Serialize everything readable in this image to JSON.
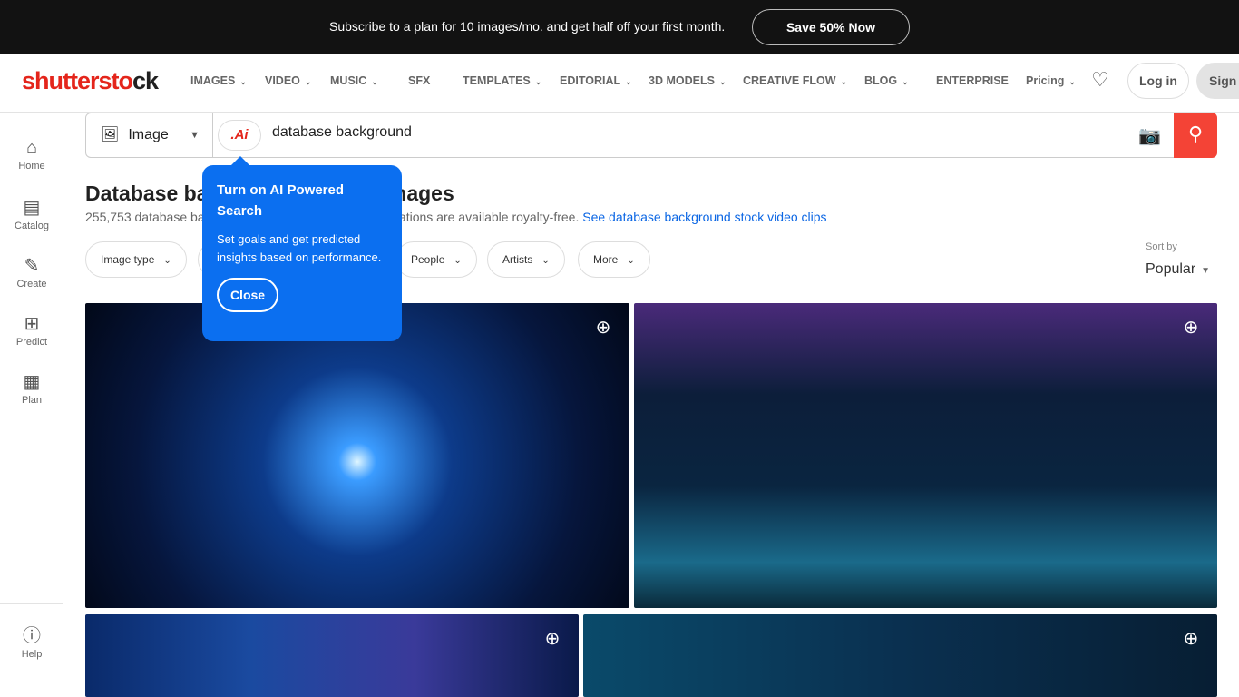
{
  "banner": {
    "message": "Subscribe to a plan for 10 images/mo. and get half off your first month.",
    "cta": "Save 50% Now"
  },
  "nav": {
    "logo_a": "shutterst",
    "logo_b": "ck",
    "items": [
      {
        "label": "IMAGES",
        "chev": true
      },
      {
        "label": "VIDEO",
        "chev": true
      },
      {
        "label": "MUSIC",
        "chev": true
      },
      {
        "label": "SFX",
        "chev": false
      },
      {
        "label": "TEMPLATES",
        "chev": true
      },
      {
        "label": "EDITORIAL",
        "chev": true
      },
      {
        "label": "3D MODELS",
        "chev": true
      },
      {
        "label": "CREATIVE FLOW",
        "chev": true
      },
      {
        "label": "BLOG",
        "chev": true
      },
      {
        "label": "ENTERPRISE",
        "chev": false
      },
      {
        "label": "Pricing",
        "chev": true
      }
    ],
    "login": "Log in",
    "signup": "Sign"
  },
  "sidebar": {
    "items": [
      {
        "label": "Home",
        "icon": "⌂"
      },
      {
        "label": "Catalog",
        "icon": "▤"
      },
      {
        "label": "Create",
        "icon": "✎"
      },
      {
        "label": "Predict",
        "icon": "⊞"
      },
      {
        "label": "Plan",
        "icon": "▦"
      }
    ],
    "help": "Help"
  },
  "search": {
    "type": "Image",
    "ai_label": ".Ai",
    "query": "database background"
  },
  "heading": {
    "title_a": "Database ba",
    "title_b": "ee images",
    "sub_a": "255,753 database ba",
    "sub_b": "d illustrations are available royalty-free.",
    "link": "See database background stock video clips"
  },
  "filters": [
    "Image type",
    "",
    "People",
    "Artists",
    "More"
  ],
  "sort": {
    "label": "Sort by",
    "value": "Popular"
  },
  "popup": {
    "title": "Turn on AI Powered Search",
    "body": "Set goals and get predicted insights based on performance.",
    "close": "Close"
  },
  "colors": {
    "brand": "#e4251b",
    "accent": "#0b6ff0",
    "link": "#0b66e4"
  }
}
